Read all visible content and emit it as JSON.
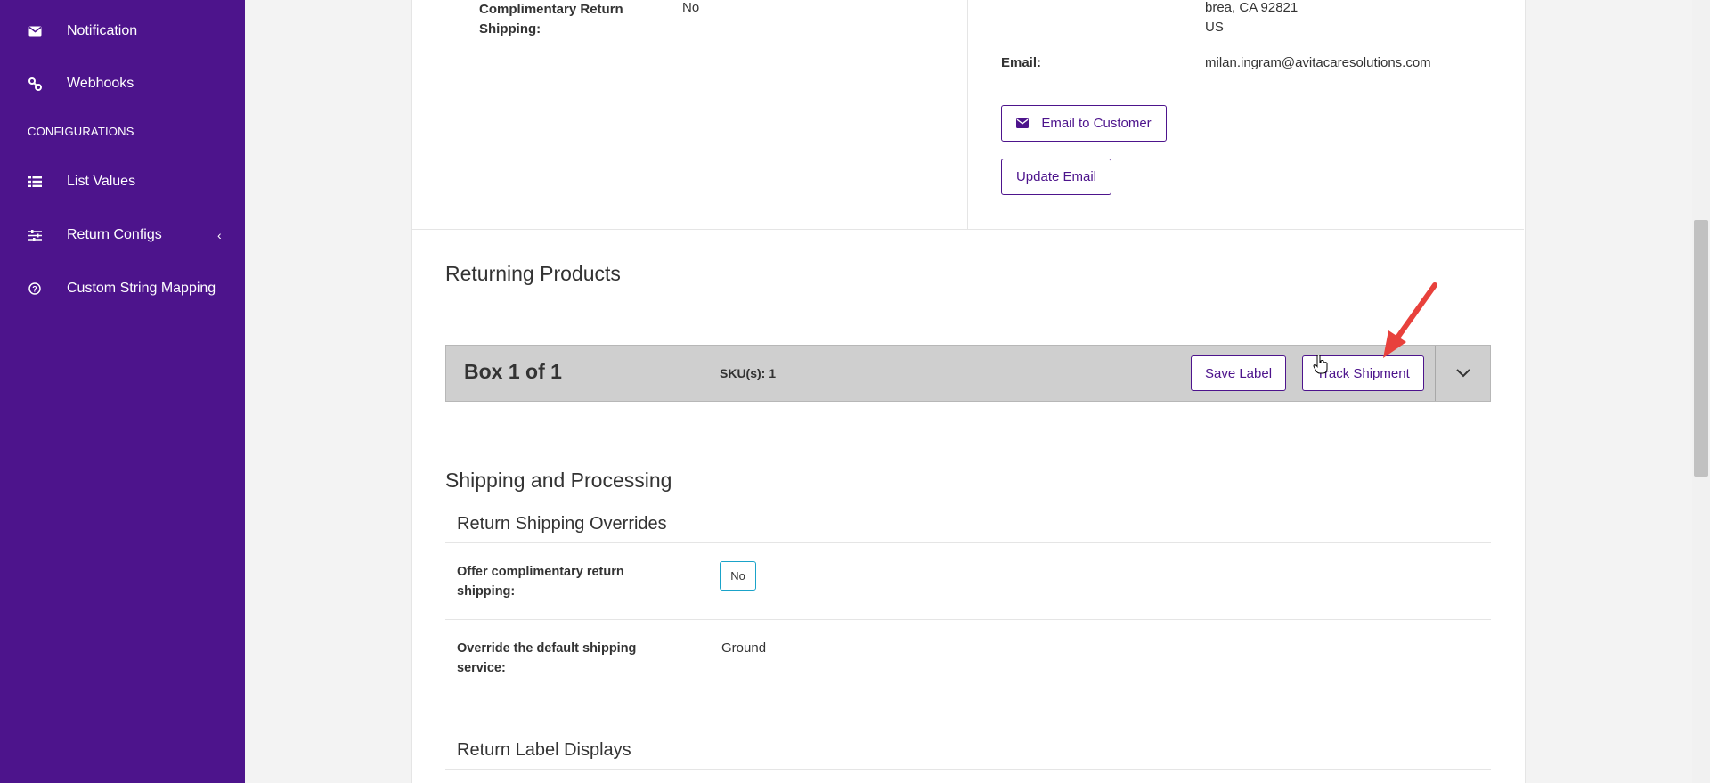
{
  "sidebar": {
    "items_top": [
      {
        "label": "Notification",
        "icon": "envelope-icon"
      },
      {
        "label": "Webhooks",
        "icon": "link-icon"
      }
    ],
    "section_title": "CONFIGURATIONS",
    "items_config": [
      {
        "label": "List Values",
        "icon": "list-icon"
      },
      {
        "label": "Return Configs",
        "icon": "sliders-icon"
      },
      {
        "label": "Custom String Mapping",
        "icon": "question-circle-icon"
      }
    ]
  },
  "details": {
    "comp_return_label": "Complimentary Return Shipping:",
    "comp_return_value": "No",
    "address_line1": "brea, CA 92821",
    "address_line2": "US",
    "email_label": "Email:",
    "email_value": "milan.ingram@avitacaresolutions.com",
    "email_to_customer_button": "Email to Customer",
    "update_email_button": "Update Email"
  },
  "returning": {
    "title": "Returning Products",
    "box_title": "Box 1 of 1",
    "sku_text": "SKU(s): 1",
    "save_label_button": "Save Label",
    "track_shipment_button": "Track Shipment"
  },
  "shipping": {
    "title": "Shipping and Processing",
    "overrides_title": "Return Shipping Overrides",
    "offer_label": "Offer complimentary return shipping:",
    "offer_value": "No",
    "override_label": "Override the default shipping service:",
    "override_value": "Ground",
    "label_displays_title": "Return Label Displays"
  },
  "colors": {
    "brand_purple": "#4d148c",
    "annotation_arrow": "#e8413c",
    "toggle_border": "#1aa3c9"
  }
}
